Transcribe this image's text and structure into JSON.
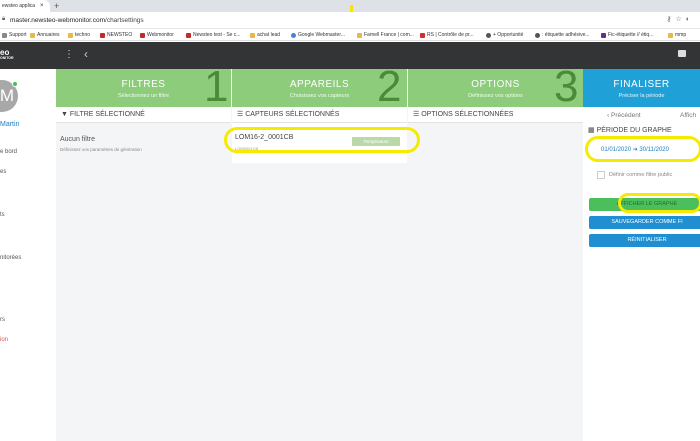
{
  "browser": {
    "tab_title": "ewsteo applica",
    "tab_close": "×",
    "new_tab": "+",
    "url_host": "master.newsteo-webmonitor.com",
    "url_path": "/chartsettings",
    "bookmarks": [
      "Support",
      "Annuaires",
      "techno",
      "NEWSTEO",
      "Webmonitor",
      "Newsteo test - Se c...",
      "achat lead",
      "Google Webmaster...",
      "Farnell France | com...",
      "RS | Contrôle de pr...",
      "+ Opportunité",
      ": étiquette adhésive...",
      "Fic-étiquette // étiq...",
      "mmp"
    ]
  },
  "app": {
    "logo": "eo\nONITOR",
    "menu_icon": "⋮",
    "back_icon": "‹"
  },
  "sidebar": {
    "avatar_letter": "M",
    "user_name": "Martin",
    "items": [
      "e bord",
      "es",
      "ts",
      "nitorées",
      "rs",
      "ion"
    ]
  },
  "steps": [
    {
      "title": "FILTRES",
      "subtitle": "Sélectionnez un filtre",
      "number": "1"
    },
    {
      "title": "APPAREILS",
      "subtitle": "Choisissez vos capteurs",
      "number": "2"
    },
    {
      "title": "OPTIONS",
      "subtitle": "Définissez vos options",
      "number": "3"
    }
  ],
  "finalize": {
    "title": "FINALISER",
    "subtitle": "Préciser la période",
    "previous": "Précédent",
    "next": "Affich",
    "period_header": "PÉRIODE DU GRAPHE",
    "date_range": "01/01/2020 ➔ 30/11/2020",
    "public_filter_label": "Définir comme filtre public",
    "buttons": {
      "show": "AFFICHER LE GRAPHE",
      "save": "SAUVEGARDER COMME FI",
      "reset": "RÉINITIALISER"
    }
  },
  "panels": {
    "filter": {
      "header": "FILTRE SÉLECTIONNÉ",
      "empty_title": "Aucun filtre",
      "empty_desc": "Définissez vos paramètres de génération"
    },
    "sensors": {
      "header": "CAPTEURS SÉLECTIONNÉS",
      "sensor_name": "LOM16-2_0001CB",
      "sensor_id": "LOM0001CB",
      "sensor_tag": "Température"
    },
    "options": {
      "header": "OPTIONS SÉLECTIONNÉES"
    }
  },
  "colors": {
    "step_green": "#8ccc7b",
    "step_number": "#4a8a38",
    "finalize_blue": "#1fa0d6",
    "btn_green": "#4cbf5d",
    "btn_blue": "#1f8fd1",
    "highlight": "#f5ea00"
  }
}
